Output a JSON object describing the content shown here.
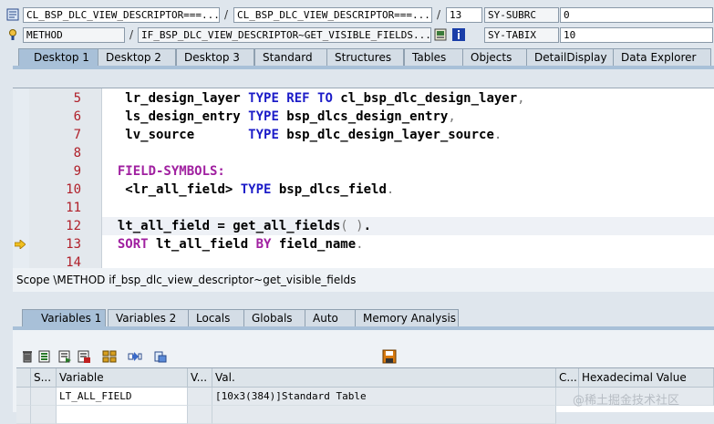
{
  "header": {
    "row1": {
      "program": "CL_BSP_DLC_VIEW_DESCRIPTOR===...",
      "include": "CL_BSP_DLC_VIEW_DESCRIPTOR===...",
      "line": "13",
      "sysvar_name": "SY-SUBRC",
      "sysvar_value": "0"
    },
    "row2": {
      "event_type": "METHOD",
      "event_name": "IF_BSP_DLC_VIEW_DESCRIPTOR~GET_VISIBLE_FIELDS...",
      "sysvar_name": "SY-TABIX",
      "sysvar_value": "10"
    }
  },
  "tabs": [
    {
      "label": "Desktop 1",
      "active": true
    },
    {
      "label": "Desktop 2"
    },
    {
      "label": "Desktop 3"
    },
    {
      "label": "Standard"
    },
    {
      "label": "Structures"
    },
    {
      "label": "Tables"
    },
    {
      "label": "Objects"
    },
    {
      "label": "DetailDisplay"
    },
    {
      "label": "Data Explorer"
    }
  ],
  "editor": {
    "line_numbers": [
      "5",
      "6",
      "7",
      "8",
      "9",
      "10",
      "11",
      "12",
      "13",
      "14"
    ],
    "lines": [
      {
        "indent": "   ",
        "p1": "lr_design_layer ",
        "k1": "TYPE REF TO",
        "p2": " cl_bsp_dlc_design_layer",
        "p3": ","
      },
      {
        "indent": "   ",
        "p1": "ls_design_entry ",
        "k1": "TYPE",
        "p2": " bsp_dlcs_design_entry",
        "p3": ","
      },
      {
        "indent": "   ",
        "p1": "lv_source       ",
        "k1": "TYPE",
        "p2": " bsp_dlc_design_layer_source",
        "p3": "."
      },
      {
        "indent": "",
        "p1": "",
        "k1": "",
        "p2": "",
        "p3": ""
      },
      {
        "indent": "  ",
        "p1": "",
        "k1": "FIELD-SYMBOLS:",
        "p2": "",
        "p3": ""
      },
      {
        "indent": "   ",
        "p1": "<lr_all_field> ",
        "k1": "TYPE",
        "p2": " bsp_dlcs_field",
        "p3": "."
      },
      {
        "indent": "",
        "p1": "",
        "k1": "",
        "p2": "",
        "p3": ""
      },
      {
        "indent": "  ",
        "p1": "lt_all_field = get_all_fields",
        "k1": "",
        "p2": "( )",
        "p3": "."
      },
      {
        "indent": "  ",
        "p1": "",
        "k1": "SORT",
        "p2": " lt_all_field ",
        "k2": "BY",
        "p4": " field_name",
        "p3": "."
      },
      {
        "indent": "",
        "p1": "",
        "k1": "",
        "p2": "",
        "p3": ""
      }
    ]
  },
  "scope": "Scope \\METHOD if_bsp_dlc_view_descriptor~get_visible_fields",
  "lower_tabs": [
    {
      "label": "Variables 1",
      "active": true
    },
    {
      "label": "Variables 2"
    },
    {
      "label": "Locals"
    },
    {
      "label": "Globals"
    },
    {
      "label": "Auto"
    },
    {
      "label": "Memory Analysis"
    }
  ],
  "grid": {
    "columns": [
      "S...",
      "Variable",
      "V...",
      "Val.",
      "C...",
      "Hexadecimal Value"
    ],
    "rows": [
      {
        "variable": "LT_ALL_FIELD",
        "value": "[10x3(384)]Standard Table"
      }
    ]
  },
  "watermark": "@稀土掘金技术社区",
  "colors": {
    "keyword": "#1c1cc8",
    "field_symbol": "#a020a0",
    "line_number": "#b0202a",
    "tab_active": "#a8c0d8"
  }
}
